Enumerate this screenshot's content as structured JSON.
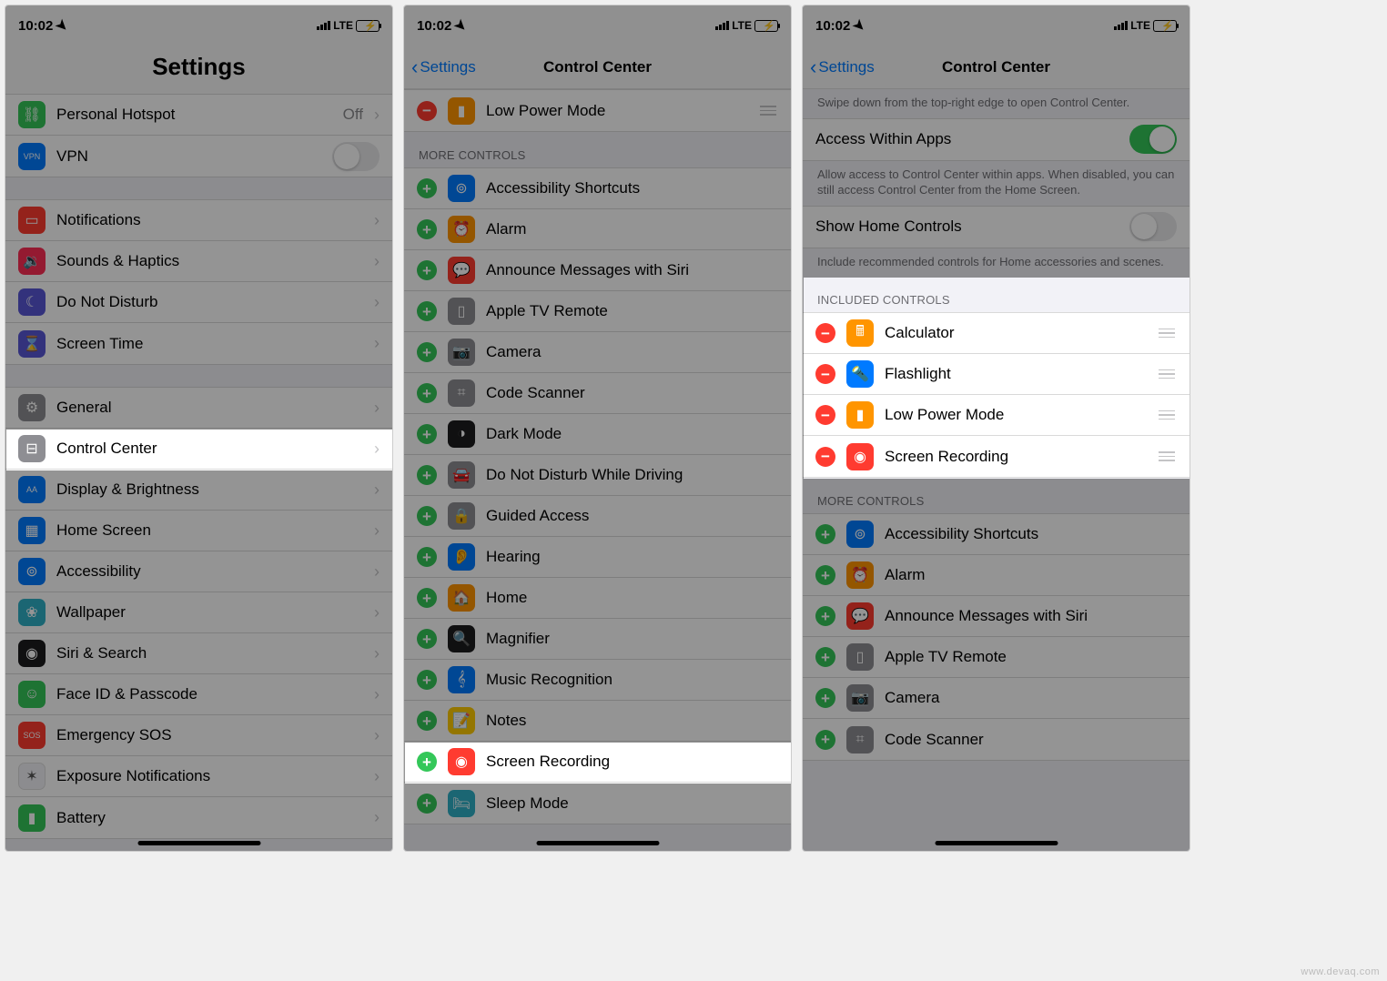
{
  "watermark": "www.devaq.com",
  "status": {
    "time": "10:02",
    "carrier": "LTE"
  },
  "screen1": {
    "title": "Settings",
    "group1": [
      {
        "name": "personal-hotspot",
        "label": "Personal Hotspot",
        "value": "Off",
        "iconBg": "bg-green",
        "glyph": "⛓"
      },
      {
        "name": "vpn",
        "label": "VPN",
        "toggle": false,
        "iconBg": "bg-blue",
        "glyph": "VPN",
        "smallText": true
      }
    ],
    "group2": [
      {
        "name": "notifications",
        "label": "Notifications",
        "iconBg": "bg-red",
        "glyph": "▭"
      },
      {
        "name": "sounds-haptics",
        "label": "Sounds & Haptics",
        "iconBg": "bg-pink",
        "glyph": "🔉"
      },
      {
        "name": "do-not-disturb",
        "label": "Do Not Disturb",
        "iconBg": "bg-purple",
        "glyph": "☾"
      },
      {
        "name": "screen-time",
        "label": "Screen Time",
        "iconBg": "bg-purple",
        "glyph": "⌛"
      }
    ],
    "group3": [
      {
        "name": "general",
        "label": "General",
        "iconBg": "bg-gray",
        "glyph": "⚙"
      },
      {
        "name": "control-center",
        "label": "Control Center",
        "iconBg": "bg-gray",
        "glyph": "⊟",
        "highlight": true
      },
      {
        "name": "display-brightness",
        "label": "Display & Brightness",
        "iconBg": "bg-blue",
        "glyph": "AA",
        "smallText": true
      },
      {
        "name": "home-screen",
        "label": "Home Screen",
        "iconBg": "bg-blue",
        "glyph": "▦"
      },
      {
        "name": "accessibility",
        "label": "Accessibility",
        "iconBg": "bg-blue",
        "glyph": "⊚"
      },
      {
        "name": "wallpaper",
        "label": "Wallpaper",
        "iconBg": "bg-teal",
        "glyph": "❀"
      },
      {
        "name": "siri-search",
        "label": "Siri & Search",
        "iconBg": "bg-dark",
        "glyph": "◉"
      },
      {
        "name": "face-id-passcode",
        "label": "Face ID & Passcode",
        "iconBg": "bg-green",
        "glyph": "☺"
      },
      {
        "name": "emergency-sos",
        "label": "Emergency SOS",
        "iconBg": "bg-red",
        "glyph": "SOS",
        "smallText": true
      },
      {
        "name": "exposure-notifications",
        "label": "Exposure Notifications",
        "iconBg": "bg-white",
        "glyph": "✶"
      },
      {
        "name": "battery",
        "label": "Battery",
        "iconBg": "bg-green",
        "glyph": "▮"
      }
    ]
  },
  "screen2": {
    "back": "Settings",
    "title": "Control Center",
    "topRow": {
      "name": "low-power-mode",
      "label": "Low Power Mode",
      "iconBg": "bg-orange",
      "glyph": "▮"
    },
    "moreHeader": "MORE CONTROLS",
    "more": [
      {
        "name": "accessibility-shortcuts",
        "label": "Accessibility Shortcuts",
        "iconBg": "bg-blue",
        "glyph": "⊚"
      },
      {
        "name": "alarm",
        "label": "Alarm",
        "iconBg": "bg-orange",
        "glyph": "⏰"
      },
      {
        "name": "announce-messages-siri",
        "label": "Announce Messages with Siri",
        "iconBg": "bg-red",
        "glyph": "💬"
      },
      {
        "name": "apple-tv-remote",
        "label": "Apple TV Remote",
        "iconBg": "bg-gray",
        "glyph": "▯"
      },
      {
        "name": "camera",
        "label": "Camera",
        "iconBg": "bg-gray",
        "glyph": "📷"
      },
      {
        "name": "code-scanner",
        "label": "Code Scanner",
        "iconBg": "bg-gray",
        "glyph": "⌗"
      },
      {
        "name": "dark-mode",
        "label": "Dark Mode",
        "iconBg": "bg-dark",
        "glyph": "◑"
      },
      {
        "name": "do-not-disturb-driving",
        "label": "Do Not Disturb While Driving",
        "iconBg": "bg-gray",
        "glyph": "🚘"
      },
      {
        "name": "guided-access",
        "label": "Guided Access",
        "iconBg": "bg-gray",
        "glyph": "🔒"
      },
      {
        "name": "hearing",
        "label": "Hearing",
        "iconBg": "bg-blue",
        "glyph": "👂"
      },
      {
        "name": "home",
        "label": "Home",
        "iconBg": "bg-orange",
        "glyph": "🏠"
      },
      {
        "name": "magnifier",
        "label": "Magnifier",
        "iconBg": "bg-dark",
        "glyph": "🔍"
      },
      {
        "name": "music-recognition",
        "label": "Music Recognition",
        "iconBg": "bg-blue",
        "glyph": "𝄞"
      },
      {
        "name": "notes",
        "label": "Notes",
        "iconBg": "bg-yellow",
        "glyph": "📝"
      },
      {
        "name": "screen-recording",
        "label": "Screen Recording",
        "iconBg": "bg-red",
        "glyph": "◉",
        "highlight": true
      },
      {
        "name": "sleep-mode",
        "label": "Sleep Mode",
        "iconBg": "bg-teal",
        "glyph": "🛏"
      }
    ]
  },
  "screen3": {
    "back": "Settings",
    "title": "Control Center",
    "hint": "Swipe down from the top-right edge to open Control Center.",
    "accessWithin": {
      "label": "Access Within Apps",
      "on": true
    },
    "accessFooter": "Allow access to Control Center within apps. When disabled, you can still access Control Center from the Home Screen.",
    "showHome": {
      "label": "Show Home Controls",
      "on": false
    },
    "showHomeFooter": "Include recommended controls for Home accessories and scenes.",
    "includedHeader": "INCLUDED CONTROLS",
    "included": [
      {
        "name": "calculator",
        "label": "Calculator",
        "iconBg": "bg-orange",
        "glyph": "🖩"
      },
      {
        "name": "flashlight",
        "label": "Flashlight",
        "iconBg": "bg-blue",
        "glyph": "🔦"
      },
      {
        "name": "low-power-mode",
        "label": "Low Power Mode",
        "iconBg": "bg-orange",
        "glyph": "▮"
      },
      {
        "name": "screen-recording",
        "label": "Screen Recording",
        "iconBg": "bg-red",
        "glyph": "◉"
      }
    ],
    "moreHeader": "MORE CONTROLS",
    "more": [
      {
        "name": "accessibility-shortcuts",
        "label": "Accessibility Shortcuts",
        "iconBg": "bg-blue",
        "glyph": "⊚"
      },
      {
        "name": "alarm",
        "label": "Alarm",
        "iconBg": "bg-orange",
        "glyph": "⏰"
      },
      {
        "name": "announce-messages-siri",
        "label": "Announce Messages with Siri",
        "iconBg": "bg-red",
        "glyph": "💬"
      },
      {
        "name": "apple-tv-remote",
        "label": "Apple TV Remote",
        "iconBg": "bg-gray",
        "glyph": "▯"
      },
      {
        "name": "camera",
        "label": "Camera",
        "iconBg": "bg-gray",
        "glyph": "📷"
      },
      {
        "name": "code-scanner",
        "label": "Code Scanner",
        "iconBg": "bg-gray",
        "glyph": "⌗"
      }
    ]
  }
}
